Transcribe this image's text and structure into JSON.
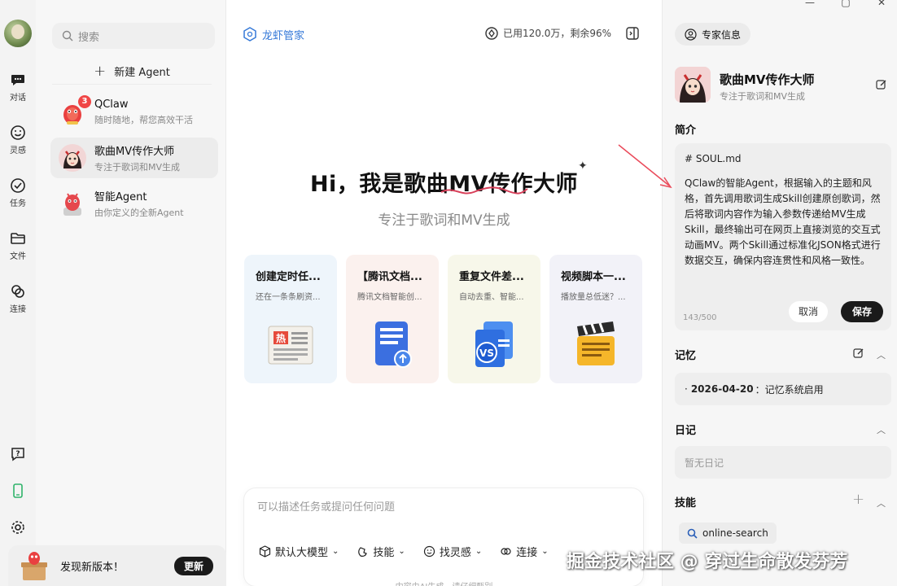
{
  "window": {
    "minimize": "—",
    "maximize": "▢",
    "close": "✕"
  },
  "rail": {
    "items": [
      {
        "label": "对话",
        "icon": "chat-icon"
      },
      {
        "label": "灵感",
        "icon": "inspiration-icon"
      },
      {
        "label": "任务",
        "icon": "task-icon"
      },
      {
        "label": "文件",
        "icon": "folder-icon"
      },
      {
        "label": "连接",
        "icon": "link-icon"
      }
    ]
  },
  "agents": {
    "search_placeholder": "搜索",
    "new_agent": "新建 Agent",
    "list": [
      {
        "name": "QClaw",
        "desc": "随时随地，帮您高效干活",
        "badge": "3",
        "active": false
      },
      {
        "name": "歌曲MV传作大师",
        "desc": "专注于歌词和MV生成",
        "active": true
      },
      {
        "name": "智能Agent",
        "desc": "由你定义的全新Agent",
        "active": false
      }
    ],
    "update": {
      "text": "发现新版本！",
      "button": "更新"
    }
  },
  "main": {
    "brand": "龙虾管家",
    "usage": "已用120.0万，剩余96%",
    "hero_title": "Hi，我是歌曲MV传作大师",
    "hero_subtitle": "专注于歌词和MV生成",
    "cards": [
      {
        "title": "创建定时任...",
        "desc": "还在一条条刷资...",
        "bg": "#eef5fb"
      },
      {
        "title": "【腾讯文档...",
        "desc": "腾讯文档智能创...",
        "bg": "#fbf1ee"
      },
      {
        "title": "重复文件差...",
        "desc": "自动去重、智能...",
        "bg": "#f7f7ea"
      },
      {
        "title": "视频脚本一...",
        "desc": "播放量总低迷？...",
        "bg": "#f2f2f8"
      }
    ],
    "composer_placeholder": "可以描述任务或提问任何问题",
    "tools": [
      {
        "label": "默认大模型",
        "icon": "cube-icon"
      },
      {
        "label": "技能",
        "icon": "skill-icon"
      },
      {
        "label": "找灵感",
        "icon": "smile-icon"
      },
      {
        "label": "连接",
        "icon": "link-icon"
      }
    ],
    "disclaimer": "内容由AI生成，请仔细甄别"
  },
  "side": {
    "tab": "专家信息",
    "expert_name": "歌曲MV传作大师",
    "expert_desc": "专注于歌词和MV生成",
    "intro_title": "简介",
    "soul_header": "# SOUL.md",
    "soul_body": "QClaw的智能Agent，根据输入的主题和风格，首先调用歌词生成Skill创建原创歌词，然后将歌词内容作为输入参数传递给MV生成Skill，最终输出可在网页上直接浏览的交互式动画MV。两个Skill通过标准化JSON格式进行数据交互，确保内容连贯性和风格一致性。",
    "char_count": "143/500",
    "cancel": "取消",
    "save": "保存",
    "memory_title": "记忆",
    "memory_date": "2026-04-20",
    "memory_text": "：记忆系统启用",
    "diary_title": "日记",
    "diary_empty": "暂无日记",
    "skills_title": "技能",
    "skill_chip": "online-search"
  },
  "watermark": "掘金技术社区 @ 穿过生命散发芬芳"
}
